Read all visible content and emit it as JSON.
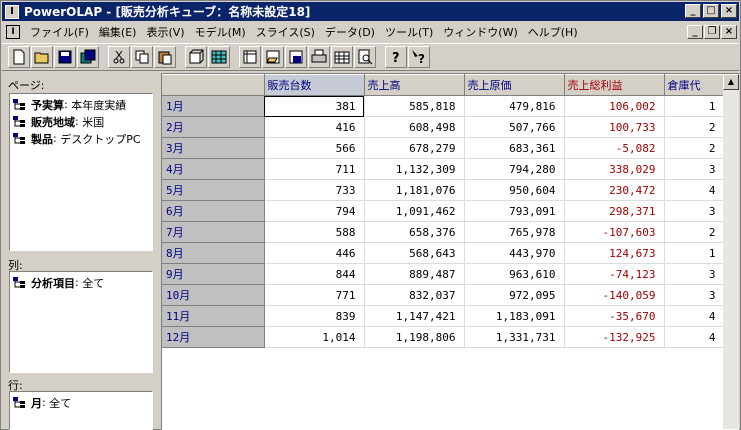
{
  "window": {
    "title": "PowerOLAP - [販売分析キューブ：名称未設定18]",
    "app_icon_glyph": "I",
    "caption_buttons": [
      "_",
      "□",
      "×"
    ],
    "mdi_buttons": [
      "_",
      "❐",
      "×"
    ]
  },
  "menubar": {
    "doc_icon_glyph": "I",
    "items": [
      {
        "label": "ファイル(F)"
      },
      {
        "label": "編集(E)"
      },
      {
        "label": "表示(V)"
      },
      {
        "label": "モデル(M)"
      },
      {
        "label": "スライス(S)"
      },
      {
        "label": "データ(D)"
      },
      {
        "label": "ツール(T)"
      },
      {
        "label": "ウィンドウ(W)"
      },
      {
        "label": "ヘルプ(H)"
      }
    ]
  },
  "toolbar": {
    "buttons": [
      "new-icon",
      "open-icon",
      "save-icon",
      "save-all-icon",
      "cut-icon",
      "copy-icon",
      "paste-icon",
      "cube-icon",
      "grid-icon",
      "slice-icon",
      "open-slice-icon",
      "save-slice-icon",
      "print-icon",
      "calculator-icon",
      "print-preview-icon",
      "help-icon",
      "context-help-icon"
    ]
  },
  "panes": {
    "page_label": "ページ:",
    "page_items": [
      {
        "name": "予実算",
        "value": "本年度実績"
      },
      {
        "name": "販売地域",
        "value": "米国"
      },
      {
        "name": "製品",
        "value": "デスクトップPC"
      }
    ],
    "column_label": "列:",
    "column_items": [
      {
        "name": "分析項目",
        "value": "全て"
      }
    ],
    "row_label": "行:",
    "row_items": [
      {
        "name": "月",
        "value": "全て"
      }
    ]
  },
  "grid": {
    "columns": [
      "販売台数",
      "売上高",
      "売上原価",
      "売上総利益",
      "倉庫代"
    ],
    "rows": [
      {
        "label": "1月",
        "values": [
          "381",
          "585,818",
          "479,816",
          "106,002",
          "1"
        ]
      },
      {
        "label": "2月",
        "values": [
          "416",
          "608,498",
          "507,766",
          "100,733",
          "2"
        ]
      },
      {
        "label": "3月",
        "values": [
          "566",
          "678,279",
          "683,361",
          "-5,082",
          "2"
        ]
      },
      {
        "label": "4月",
        "values": [
          "711",
          "1,132,309",
          "794,280",
          "338,029",
          "3"
        ]
      },
      {
        "label": "5月",
        "values": [
          "733",
          "1,181,076",
          "950,604",
          "230,472",
          "4"
        ]
      },
      {
        "label": "6月",
        "values": [
          "794",
          "1,091,462",
          "793,091",
          "298,371",
          "3"
        ]
      },
      {
        "label": "7月",
        "values": [
          "588",
          "658,376",
          "765,978",
          "-107,603",
          "2"
        ]
      },
      {
        "label": "8月",
        "values": [
          "446",
          "568,643",
          "443,970",
          "124,673",
          "1"
        ]
      },
      {
        "label": "9月",
        "values": [
          "844",
          "889,487",
          "963,610",
          "-74,123",
          "3"
        ]
      },
      {
        "label": "10月",
        "values": [
          "771",
          "832,037",
          "972,095",
          "-140,059",
          "3"
        ]
      },
      {
        "label": "11月",
        "values": [
          "839",
          "1,147,421",
          "1,183,091",
          "-35,670",
          "4"
        ]
      },
      {
        "label": "12月",
        "values": [
          "1,014",
          "1,198,806",
          "1,331,731",
          "-132,925",
          "4"
        ]
      }
    ]
  },
  "colors": {
    "title_bar": "#0a246a",
    "header_text": "#000080",
    "profit_text": "#a00000"
  }
}
